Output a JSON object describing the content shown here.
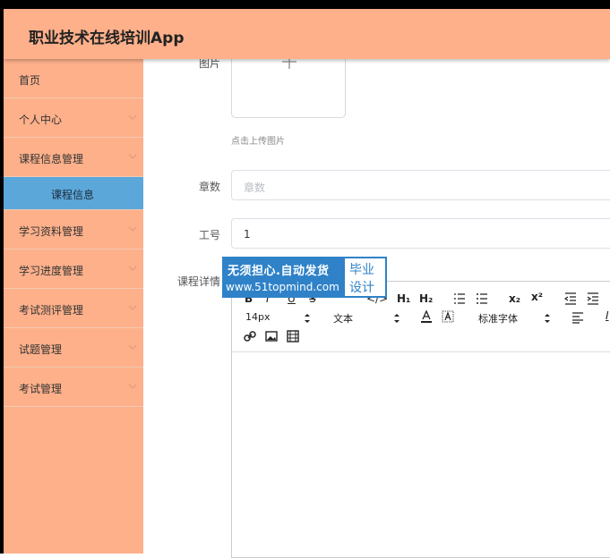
{
  "app": {
    "title": "职业技术在线培训App"
  },
  "colors": {
    "header": "#fdb08a",
    "sidebar": "#fdb08a",
    "active_item": "#5ba7d9",
    "watermark_blue": "#2f82c8"
  },
  "sidebar": {
    "items": [
      {
        "label": "首页",
        "icon": "none"
      },
      {
        "label": "个人中心",
        "icon": "chevron-down-icon"
      },
      {
        "label": "课程信息管理",
        "icon": "chevron-down-icon"
      },
      {
        "label": "课程信息",
        "sub": true,
        "active": true
      },
      {
        "label": "学习资料管理",
        "icon": "chevron-down-icon"
      },
      {
        "label": "学习进度管理",
        "icon": "chevron-down-icon"
      },
      {
        "label": "考试测评管理",
        "icon": "chevron-down-icon"
      },
      {
        "label": "试题管理",
        "icon": "chevron-down-icon"
      },
      {
        "label": "考试管理",
        "icon": "chevron-down-icon"
      }
    ]
  },
  "form": {
    "image_label": "图片",
    "upload_hint": "点击上传图片",
    "chapter_label": "章数",
    "chapter_placeholder": "章数",
    "staff_label": "工号",
    "staff_value": "1",
    "detail_label": "课程详情"
  },
  "editor": {
    "toolbar": {
      "h1": "H₁",
      "h2": "H₂",
      "subscript": "x₂",
      "superscript": "x²",
      "font_size": "14px",
      "block_format": "文本",
      "font_family": "标准字体"
    }
  },
  "watermark": {
    "line1": "无须担心.自动发货",
    "line2": "www.51topmind.com",
    "right_top": "毕业",
    "right_bottom": "设计"
  }
}
